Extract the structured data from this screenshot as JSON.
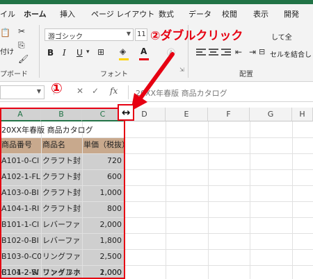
{
  "ribbon_tabs": [
    "イル",
    "ホーム",
    "挿入",
    "ページ レイアウト",
    "数式",
    "データ",
    "校閲",
    "表示",
    "開発"
  ],
  "active_tab": "ホーム",
  "ribbon": {
    "clipboard_label": "プボード",
    "paste_partial": "付け",
    "font_name": "游ゴシック",
    "font_size": "11",
    "font_group_label": "フォント",
    "align_group_label": "配置",
    "wrap_text": "して全",
    "merge_center": "セルを結合し",
    "bold": "B",
    "italic": "I",
    "underline": "U",
    "font_color_letter": "A"
  },
  "formula_bar": {
    "fx_label": "fx",
    "content": "20XX年春版 商品カタログ"
  },
  "columns": [
    "A",
    "B",
    "C",
    "D",
    "E",
    "F",
    "G",
    "H"
  ],
  "sheet": {
    "title": "20XX年春版 商品カタログ",
    "headers": [
      "商品番号",
      "商品名",
      "単価（税抜）"
    ],
    "rows": [
      [
        "A101-0-Cl",
        "クラフト封",
        "720"
      ],
      [
        "A102-1-FL",
        "クラフト封",
        "600"
      ],
      [
        "A103-0-BI",
        "クラフト封",
        "1,000"
      ],
      [
        "A104-1-RI",
        "クラフト封",
        "800"
      ],
      [
        "B101-1-Cl",
        "レバーファ",
        "2,000"
      ],
      [
        "B102-0-BI",
        "レバーファ",
        "1,800"
      ],
      [
        "B103-0-C0",
        "リングファ",
        "2,500"
      ],
      [
        "B104-2-SI",
        "リングファ",
        "2,000"
      ],
      [
        "C101-2-W",
        "ファイルホ",
        "1,000"
      ]
    ]
  },
  "annotations": {
    "step1": "①",
    "step2_text": "②ダブルクリック",
    "resize_cursor": "↔"
  },
  "colors": {
    "excel_green": "#217346",
    "annotation_red": "#e60012",
    "header_fill": "#c8a98d",
    "selection_gray": "#cfcfcf"
  }
}
